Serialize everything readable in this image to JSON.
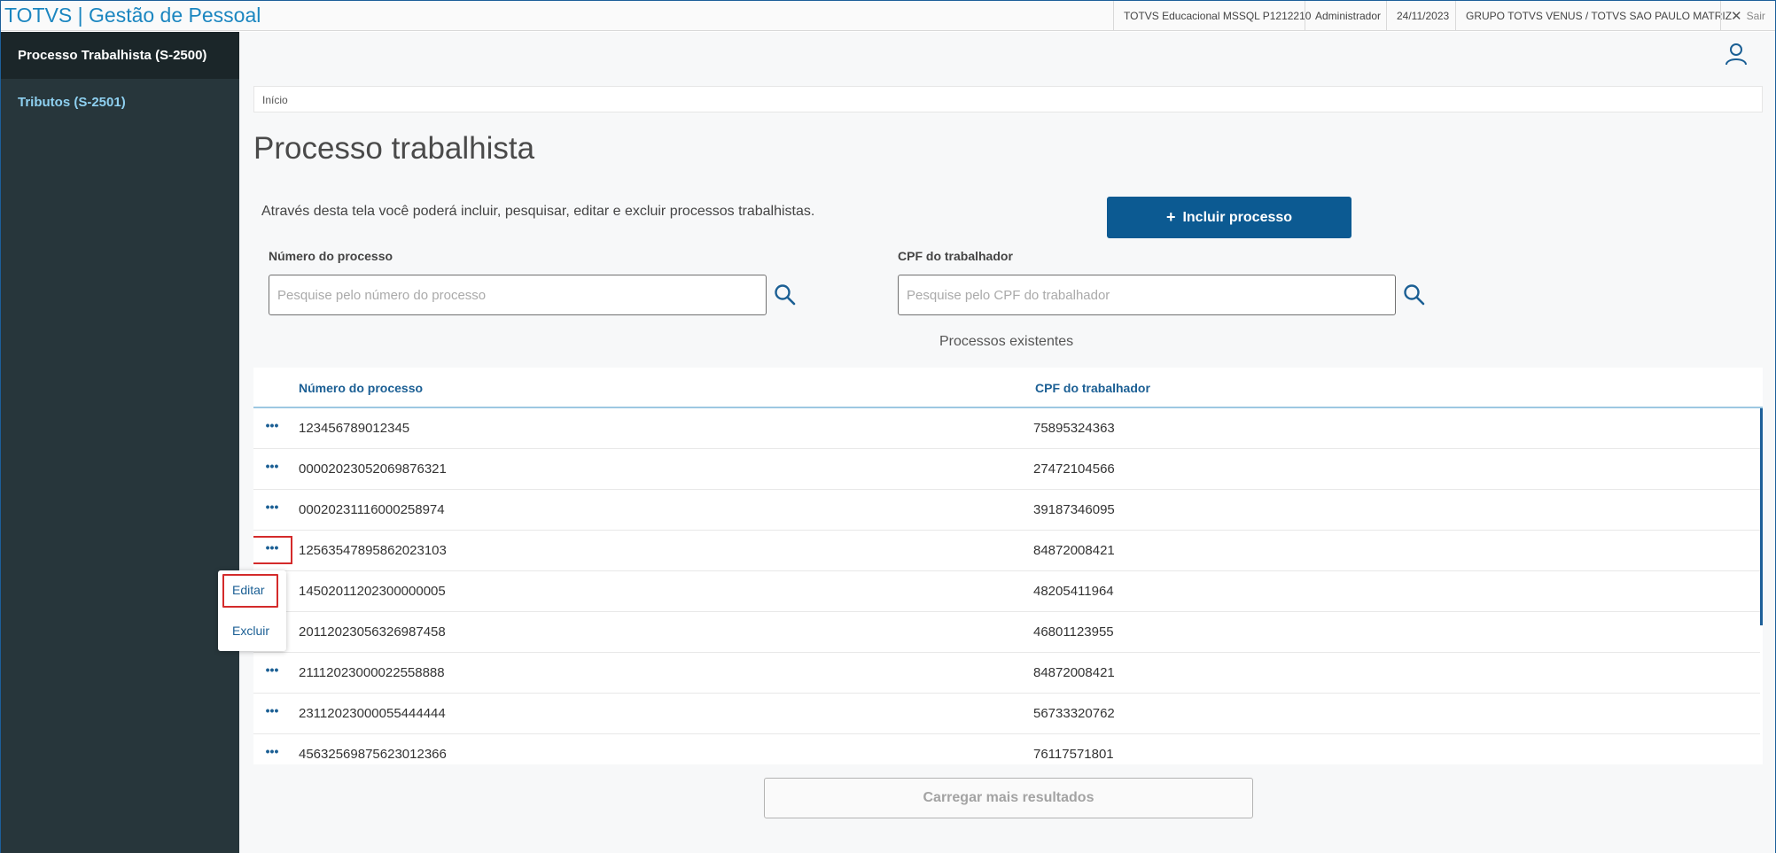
{
  "app": {
    "title": "TOTVS | Gestão de Pessoal",
    "info": [
      "TOTVS Educacional MSSQL P1212210",
      "Administrador",
      "24/11/2023",
      "GRUPO TOTVS VENUS / TOTVS SAO PAULO MATRIZ"
    ],
    "exit_label": "Sair"
  },
  "sidebar": {
    "items": [
      {
        "label": "Processo Trabalhista (S-2500)"
      },
      {
        "label": "Tributos (S-2501)"
      }
    ]
  },
  "main": {
    "breadcrumb": "Início",
    "page_title": "Processo trabalhista",
    "description": "Através desta tela você poderá incluir, pesquisar, editar e excluir processos trabalhistas.",
    "add_button": "Incluir processo",
    "process_number_label": "Número do processo",
    "process_number_placeholder": "Pesquise pelo número do processo",
    "cpf_label": "CPF do trabalhador",
    "cpf_placeholder": "Pesquise pelo CPF do trabalhador",
    "list_title": "Processos existentes",
    "load_more": "Carregar mais resultados"
  },
  "table": {
    "columns": [
      "Número do processo",
      "CPF do trabalhador"
    ],
    "rows": [
      {
        "numero": "123456789012345",
        "cpf": "75895324363"
      },
      {
        "numero": "00002023052069876321",
        "cpf": "27472104566"
      },
      {
        "numero": "00020231116000258974",
        "cpf": "39187346095"
      },
      {
        "numero": "12563547895862023103",
        "cpf": "84872008421"
      },
      {
        "numero": "14502011202300000005",
        "cpf": "48205411964"
      },
      {
        "numero": "20112023056326987458",
        "cpf": "46801123955"
      },
      {
        "numero": "21112023000022558888",
        "cpf": "84872008421"
      },
      {
        "numero": "23112023000055444444",
        "cpf": "56733320762"
      },
      {
        "numero": "45632569875623012366",
        "cpf": "76117571801"
      }
    ]
  },
  "popup_menu": {
    "items": [
      "Editar",
      "Excluir"
    ]
  },
  "colors": {
    "brand": "#1b86c0",
    "sidebar": "#27363b",
    "primary_button": "#0c5a92",
    "highlight": "#d42b2b"
  }
}
